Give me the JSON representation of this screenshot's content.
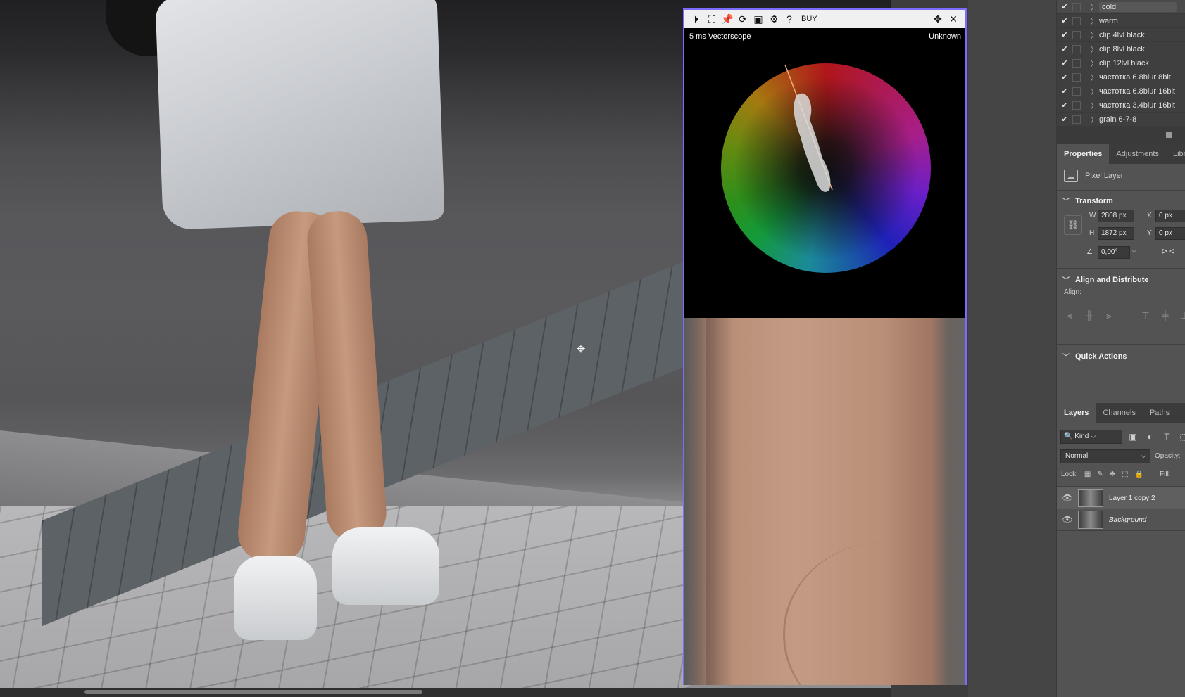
{
  "vectorscope": {
    "toolbar": {
      "icons": [
        "play-circle-icon",
        "crop-icon",
        "pin-icon",
        "refresh-icon",
        "image-icon",
        "gear-icon",
        "help-icon"
      ],
      "buy_label": "BUY"
    },
    "status_left": "5 ms Vectorscope",
    "status_right": "Unknown"
  },
  "layer_styles": {
    "items": [
      {
        "label": "cold",
        "checked": true,
        "selected": true
      },
      {
        "label": "warm",
        "checked": true
      },
      {
        "label": "clip 4lvl black",
        "checked": true
      },
      {
        "label": "clip 8lvl black",
        "checked": true
      },
      {
        "label": "clip 12lvl black",
        "checked": true
      },
      {
        "label": "частотка 6.8blur 8bit",
        "checked": true
      },
      {
        "label": "частотка 6.8blur 16bit",
        "checked": true
      },
      {
        "label": "частотка 3.4blur 16bit",
        "checked": true
      },
      {
        "label": "grain 6-7-8",
        "checked": true
      }
    ]
  },
  "properties": {
    "tabs": [
      "Properties",
      "Adjustments",
      "Librari"
    ],
    "kind_label": "Pixel Layer",
    "transform": {
      "title": "Transform",
      "w_label": "W",
      "w_value": "2808 px",
      "h_label": "H",
      "h_value": "1872 px",
      "x_label": "X",
      "x_value": "0 px",
      "y_label": "Y",
      "y_value": "0 px",
      "angle_value": "0,00°"
    },
    "align": {
      "title": "Align and Distribute",
      "sub_label": "Align:"
    },
    "quick_actions": {
      "title": "Quick Actions"
    }
  },
  "layers": {
    "tabs": [
      "Layers",
      "Channels",
      "Paths"
    ],
    "kind_filter": "Kind",
    "blend_mode": "Normal",
    "opacity_label": "Opacity:",
    "lock_label": "Lock:",
    "fill_label": "Fill:",
    "items": [
      {
        "name": "Layer 1 copy 2",
        "visible": true,
        "selected": true
      },
      {
        "name": "Background",
        "visible": true,
        "italic": true
      }
    ]
  },
  "colors": {
    "accent_border": "#7b6cff",
    "panel_bg": "#535353",
    "dark_bg": "#3f3f3f"
  }
}
